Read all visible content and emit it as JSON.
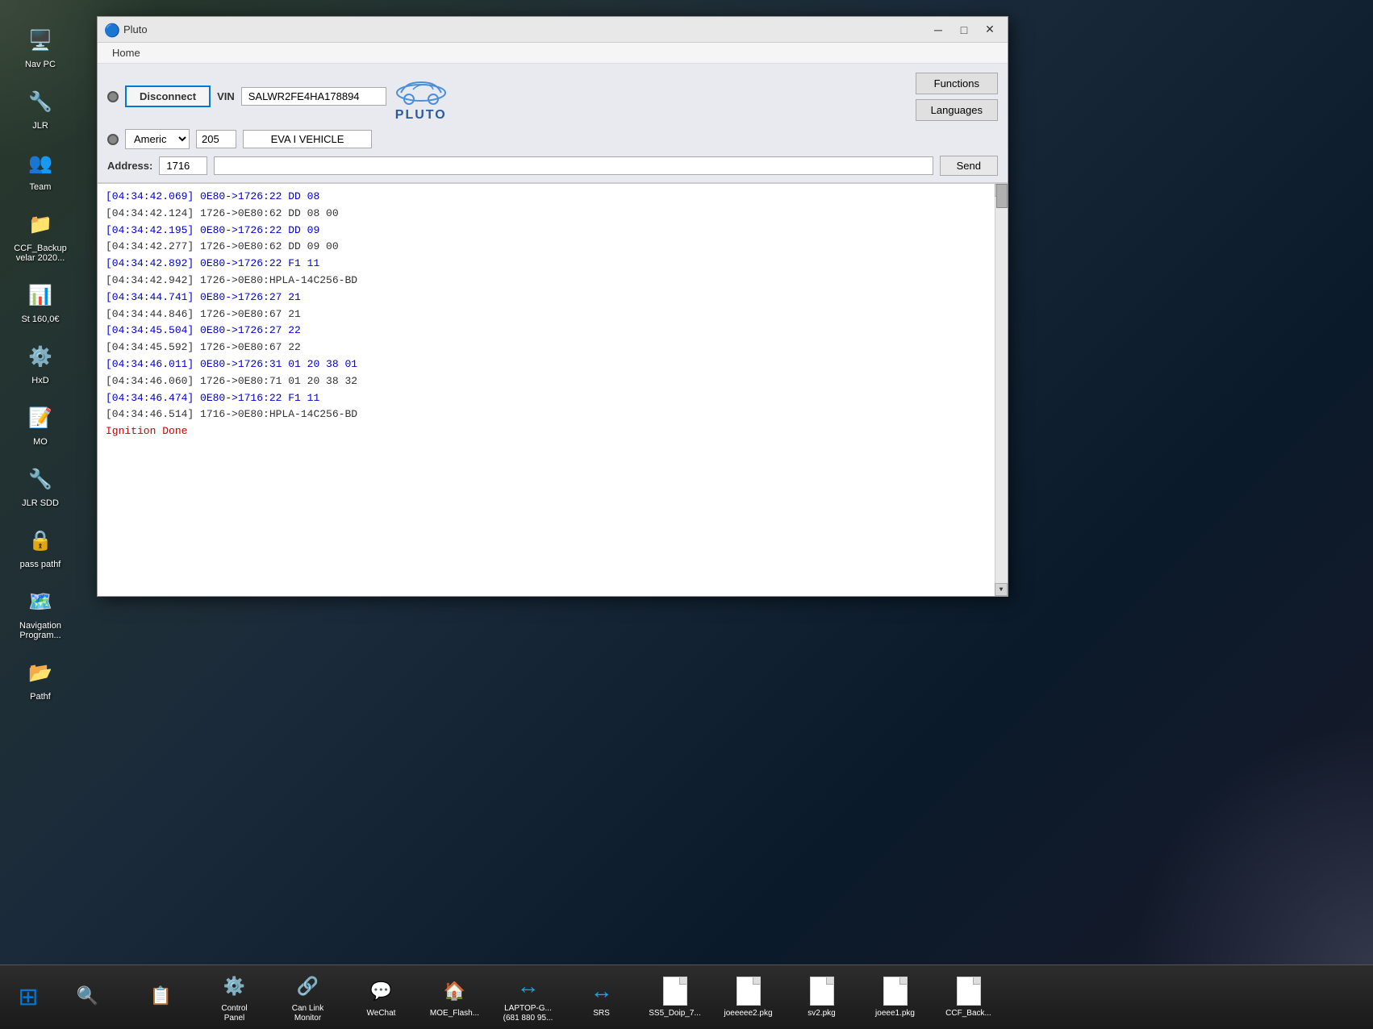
{
  "window": {
    "title": "Pluto",
    "icon": "🔵"
  },
  "menu": {
    "home_label": "Home"
  },
  "toolbar": {
    "disconnect_label": "Disconnect",
    "vin_label": "VIN",
    "vin_value": "SALWR2FE4HA178894",
    "region_value": "Americ",
    "num_value": "205",
    "vehicle_label": "EVA I VEHICLE",
    "functions_label": "Functions",
    "languages_label": "Languages",
    "address_label": "Address:",
    "address_value": "1716",
    "send_label": "Send"
  },
  "log": {
    "lines": [
      {
        "text": "[04:34:42.069] 0E80->1726:22 DD 08",
        "style": "blue"
      },
      {
        "text": "[04:34:42.124] 1726->0E80:62 DD 08 00",
        "style": "black"
      },
      {
        "text": "[04:34:42.195] 0E80->1726:22 DD 09",
        "style": "blue"
      },
      {
        "text": "[04:34:42.277] 1726->0E80:62 DD 09 00",
        "style": "black"
      },
      {
        "text": "[04:34:42.892] 0E80->1726:22 F1 11",
        "style": "blue"
      },
      {
        "text": "[04:34:42.942] 1726->0E80:HPLA-14C256-BD",
        "style": "black"
      },
      {
        "text": "[04:34:44.741] 0E80->1726:27 21",
        "style": "blue"
      },
      {
        "text": "[04:34:44.846] 1726->0E80:67 21",
        "style": "black"
      },
      {
        "text": "[04:34:45.504] 0E80->1726:27 22",
        "style": "blue"
      },
      {
        "text": "[04:34:45.592] 1726->0E80:67 22",
        "style": "black"
      },
      {
        "text": "[04:34:46.011] 0E80->1726:31 01 20 38 01",
        "style": "blue"
      },
      {
        "text": "[04:34:46.060] 1726->0E80:71 01 20 38 32",
        "style": "black"
      },
      {
        "text": "[04:34:46.474] 0E80->1716:22 F1 11",
        "style": "blue"
      },
      {
        "text": "[04:34:46.514] 1716->0E80:HPLA-14C256-BD",
        "style": "black"
      },
      {
        "text": "Ignition Done",
        "style": "red"
      }
    ]
  },
  "desktop_icons": [
    {
      "label": "Nav PC",
      "icon": "🖥️"
    },
    {
      "label": "JLR",
      "icon": "🔧"
    },
    {
      "label": "Team",
      "icon": "👥"
    },
    {
      "label": "CCF_Backup\nvelar 2020...",
      "icon": "📁"
    },
    {
      "label": "St\n160,0€",
      "icon": "📊"
    },
    {
      "label": "HxD",
      "icon": "⚙️"
    },
    {
      "label": "MO",
      "icon": "📝"
    },
    {
      "label": "JLR SDD",
      "icon": "🔧"
    },
    {
      "label": "pass\npathf",
      "icon": "🔒"
    },
    {
      "label": "Navigation\nProgram...",
      "icon": "🗺️"
    },
    {
      "label": "Pathf",
      "icon": "📂"
    }
  ],
  "taskbar": {
    "start_icon": "⊞",
    "icons": [
      {
        "label": "Control\nPanel",
        "type": "icon",
        "emoji": "⚙️"
      },
      {
        "label": "Can Link\nMonitor",
        "type": "icon",
        "emoji": "🔗"
      },
      {
        "label": "WeChat",
        "type": "icon",
        "emoji": "💬"
      },
      {
        "label": "MOE_Flash...",
        "type": "icon",
        "emoji": "🏠"
      },
      {
        "label": "LAPTOP-G...\n(681 880 95...",
        "type": "icon",
        "emoji": "↔️"
      },
      {
        "label": "SRS",
        "type": "icon",
        "emoji": "↔️"
      },
      {
        "label": "SS5_Doip_7...",
        "type": "file",
        "ext": ""
      },
      {
        "label": "joeeeee2.pkg",
        "type": "file",
        "ext": ""
      },
      {
        "label": "sv2.pkg",
        "type": "file",
        "ext": ""
      },
      {
        "label": "joeee1.pkg",
        "type": "file",
        "ext": ""
      },
      {
        "label": "CCF_Back...",
        "type": "file",
        "ext": ""
      }
    ]
  }
}
